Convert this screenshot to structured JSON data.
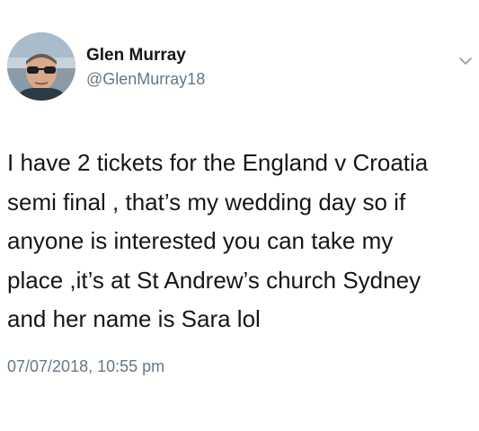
{
  "author": {
    "name": "Glen Murray",
    "handle": "@GlenMurray18",
    "avatar_icon": "profile-photo"
  },
  "menu_icon": "chevron-down-icon",
  "tweet": {
    "lines": [
      "I have 2 tickets for the England v Croatia",
      "semi final , that’s my wedding day so if",
      "anyone is interested you can take my",
      "place ,it’s at St Andrew’s church Sydney",
      "and her name is Sara  lol"
    ],
    "timestamp": "07/07/2018, 10:55 pm"
  },
  "colors": {
    "text_primary": "#14171a",
    "text_secondary": "#657786",
    "background": "#ffffff"
  }
}
